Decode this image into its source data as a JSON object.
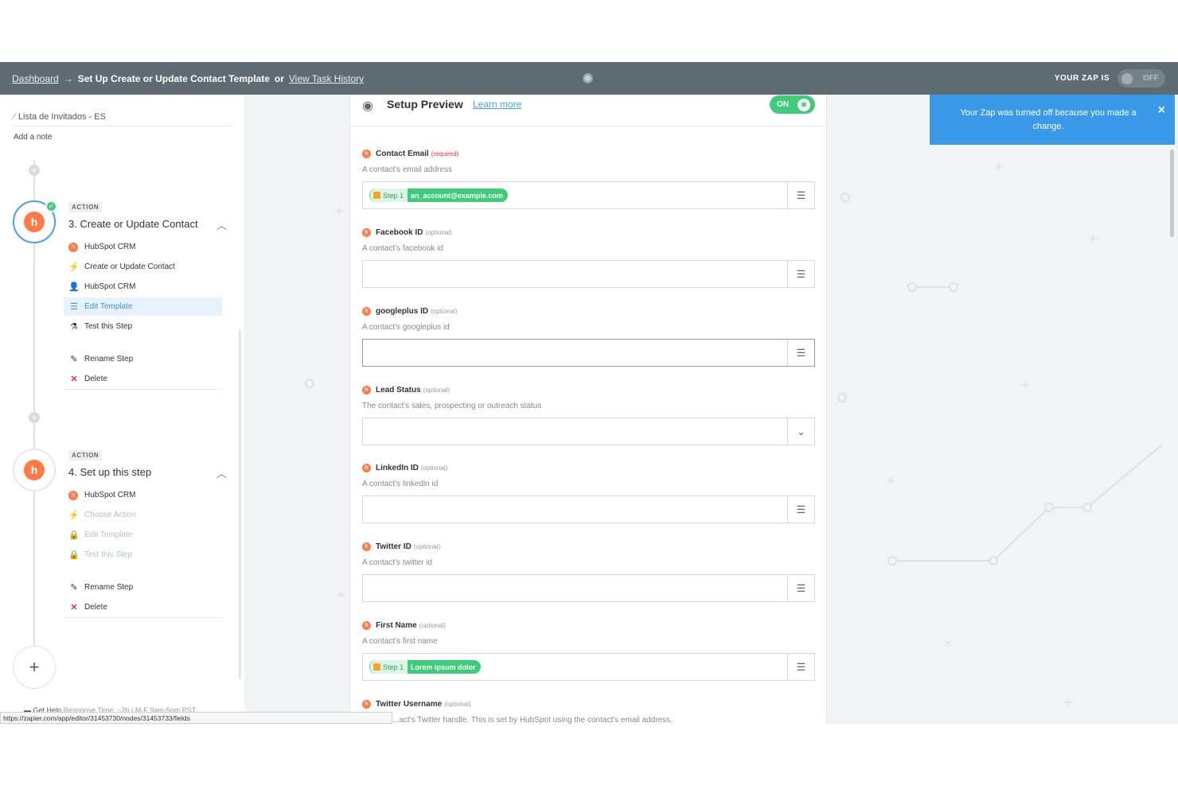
{
  "topbar": {
    "dashboard": "Dashboard",
    "arrow": "→",
    "title": "Set Up Create or Update Contact Template",
    "or": "or",
    "history": "View Task History",
    "zap_is": "YOUR ZAP IS",
    "toggle": "OFF"
  },
  "sidebar": {
    "zap_name": "Lista de Invitados - ES",
    "add_note": "Add a note",
    "steps": [
      {
        "tag": "ACTION",
        "title": "3. Create or Update Contact",
        "items": [
          "HubSpot CRM",
          "Create or Update Contact",
          "HubSpot CRM",
          "Edit Template",
          "Test this Step"
        ],
        "rename": "Rename Step",
        "delete": "Delete"
      },
      {
        "tag": "ACTION",
        "title": "4. Set up this step",
        "items": [
          "HubSpot CRM",
          "Choose Action",
          "Edit Template",
          "Test this Step"
        ],
        "rename": "Rename Step",
        "delete": "Delete"
      }
    ],
    "help": "Get Help",
    "help_detail": "Response Time: ~2h | M-F 9am-5pm PST"
  },
  "status_url": "https://zapier.com/app/editor/31453730/nodes/31453733/fields",
  "panel": {
    "title": "Setup Preview",
    "learn": "Learn more",
    "toggle": "ON",
    "fields": [
      {
        "label": "Contact Email",
        "tag": "(required)",
        "help": "A contact's email address",
        "pill_step": "Step 1",
        "pill_value": "an_account@example.com"
      },
      {
        "label": "Facebook ID",
        "tag": "(optional)",
        "help": "A contact's facebook id"
      },
      {
        "label": "googleplus ID",
        "tag": "(optional)",
        "help": "A contact's googleplus id"
      },
      {
        "label": "Lead Status",
        "tag": "(optional)",
        "help": "The contact's sales, prospecting or outreach status"
      },
      {
        "label": "LinkedIn ID",
        "tag": "(optional)",
        "help": "A contact's linkedin id"
      },
      {
        "label": "Twitter ID",
        "tag": "(optional)",
        "help": "A contact's twitter id"
      },
      {
        "label": "First Name",
        "tag": "(optional)",
        "help": "A contact's first name",
        "pill_step": "Step 1",
        "pill_value": "Lorem ipsum dolor"
      },
      {
        "label": "Twitter Username",
        "tag": "(optional)",
        "help": "...act's Twitter handle. This is set by HubSpot using the contact's email address."
      }
    ]
  },
  "toast": {
    "message": "Your Zap was turned off because you made a change.",
    "close": "×"
  },
  "icons": {
    "gear": "gear-icon",
    "eye": "eye-icon",
    "field_menu": "field-options-icon",
    "dropdown": "chevron-down-icon"
  },
  "colors": {
    "topbar": "#5f6b73",
    "accent_blue": "#3a99e8",
    "green": "#3fcc7a",
    "hubspot_orange": "#ff7a45",
    "delete_red": "#e0362b"
  }
}
